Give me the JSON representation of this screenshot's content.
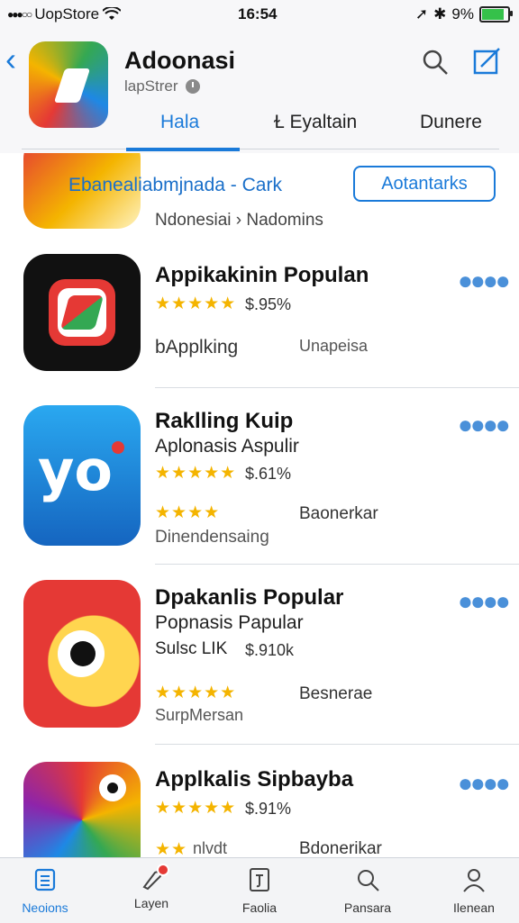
{
  "status_bar": {
    "carrier": "UopStore",
    "time": "16:54",
    "battery": "9%"
  },
  "header": {
    "title": "Adoonasi",
    "subtitle": "lapStrer",
    "tabs": [
      {
        "label": "Hala"
      },
      {
        "label": "Ɫ Eyaltain"
      },
      {
        "label": "Dunere"
      }
    ]
  },
  "banner": {
    "text": "Ebanealiabmjnada - Cark",
    "button": "Aotantarks",
    "sub": "Ndonesiai › Nadomins"
  },
  "apps": [
    {
      "name": "Appikakinin Populan",
      "stars": "★★★★★",
      "price": "$.95%",
      "category": "bApplking",
      "meta": "Unapeisa"
    },
    {
      "name": "Raklling Kuip",
      "subtitle": "Aplonasis Aspulir",
      "stars": "★★★★★",
      "price": "$.61%",
      "stars2": "★★★★",
      "category": "Baonerkar",
      "meta": "Dinendensaing"
    },
    {
      "name": "Dpakanlis Popular",
      "subtitle": "Popnasis Papular",
      "rank": "Sulsc LIK",
      "price": "$.910k",
      "stars": "★★★★★",
      "category": "Besnerae",
      "meta": "SurpMersan"
    },
    {
      "name": "Applkalis Sipbayba",
      "stars": "★★★★★",
      "price": "$.91%",
      "stars2": "★★",
      "partial_text": "nlvdt",
      "category": "Bdonerikar"
    }
  ],
  "tab_bar": [
    {
      "label": "Neoions"
    },
    {
      "label": "Layen"
    },
    {
      "label": "Faolia"
    },
    {
      "label": "Pansara"
    },
    {
      "label": "Ilenean"
    }
  ]
}
